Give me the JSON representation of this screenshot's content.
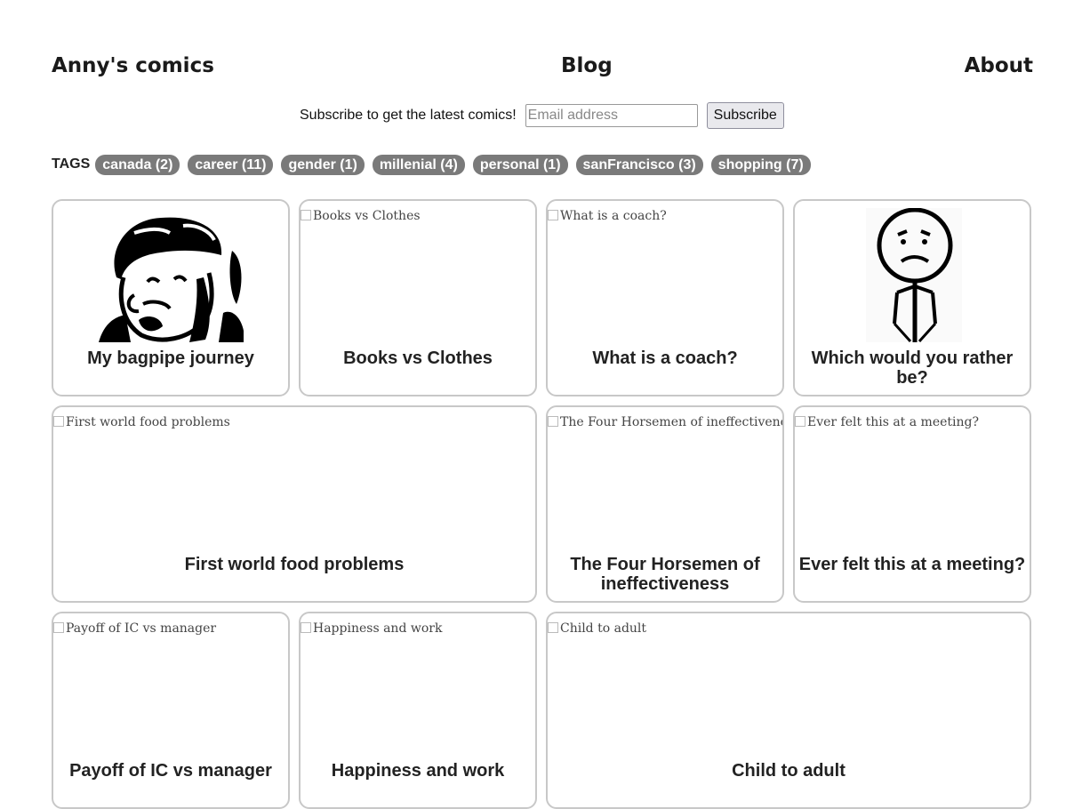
{
  "nav": {
    "brand": "Anny's comics",
    "blog": "Blog",
    "about": "About"
  },
  "subscribe": {
    "label": "Subscribe to get the latest comics!",
    "placeholder": "Email address",
    "button": "Subscribe"
  },
  "tags": {
    "label": "TAGS",
    "items": [
      "canada (2)",
      "career (11)",
      "gender (1)",
      "millenial (4)",
      "personal (1)",
      "sanFrancisco (3)",
      "shopping (7)"
    ]
  },
  "comics": [
    {
      "title": "My bagpipe journey",
      "alt": ""
    },
    {
      "title": "Books vs Clothes",
      "alt": "Books vs Clothes"
    },
    {
      "title": "What is a coach?",
      "alt": "What is a coach?"
    },
    {
      "title": "Which would you rather be?",
      "alt": ""
    },
    {
      "title": "First world food problems",
      "alt": "First world food problems"
    },
    {
      "title": "The Four Horsemen of ineffectiveness",
      "alt": "The Four Horsemen of ineffectiveness"
    },
    {
      "title": "Ever felt this at a meeting?",
      "alt": "Ever felt this at a meeting?"
    },
    {
      "title": "Payoff of IC vs manager",
      "alt": "Payoff of IC vs manager"
    },
    {
      "title": "Happiness and work",
      "alt": "Happiness and work"
    },
    {
      "title": "Child to adult",
      "alt": "Child to adult"
    }
  ]
}
